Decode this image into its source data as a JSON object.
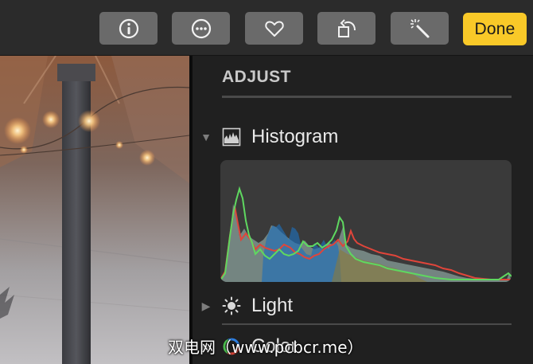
{
  "toolbar": {
    "buttons": [
      {
        "name": "info-button",
        "icon": "info-icon"
      },
      {
        "name": "more-button",
        "icon": "ellipsis-icon"
      },
      {
        "name": "favorite-button",
        "icon": "heart-icon"
      },
      {
        "name": "rotate-button",
        "icon": "rotate-left-icon"
      },
      {
        "name": "enhance-button",
        "icon": "magic-wand-icon"
      }
    ],
    "done_label": "Done",
    "accent_color": "#f9c928",
    "button_color": "#6a6a6a"
  },
  "adjust": {
    "title": "ADJUST",
    "sections": {
      "histogram": {
        "label": "Histogram",
        "icon": "histogram-icon",
        "expanded": true
      },
      "light": {
        "label": "Light",
        "icon": "sun-icon",
        "expanded": false
      },
      "color": {
        "label": "Color",
        "icon": "color-wheel-icon",
        "expanded": false
      }
    }
  },
  "histogram_colors": {
    "red": "#e0453a",
    "green": "#5fd860",
    "blue": "#1f6fb8"
  },
  "watermark": "双电网（www.pcbcr.me）"
}
